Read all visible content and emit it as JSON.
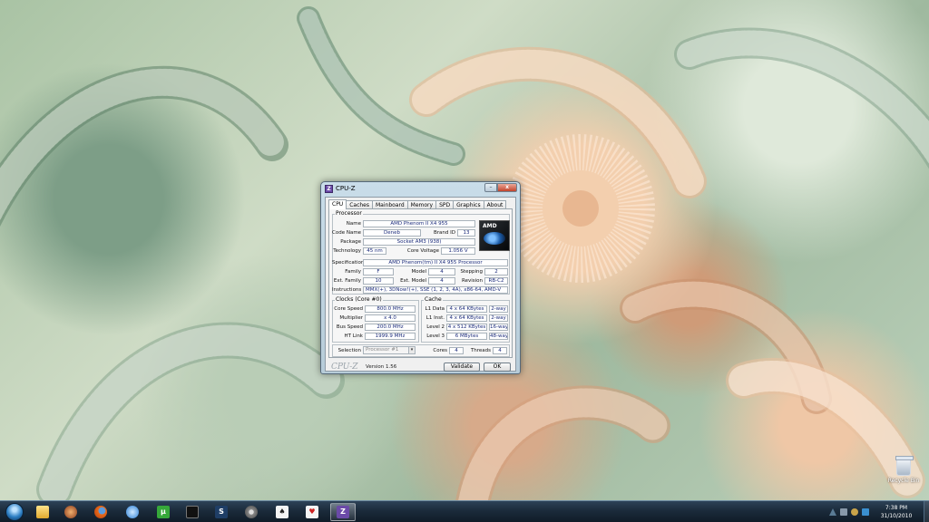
{
  "window": {
    "title": "CPU-Z",
    "icon_label": "Z",
    "min_label": "–",
    "close_label": "x"
  },
  "tabs": [
    "CPU",
    "Caches",
    "Mainboard",
    "Memory",
    "SPD",
    "Graphics",
    "About"
  ],
  "processor": {
    "legend": "Processor",
    "name_label": "Name",
    "name": "AMD Phenom II X4 955",
    "codename_label": "Code Name",
    "codename": "Deneb",
    "brandid_label": "Brand ID",
    "brandid": "13",
    "package_label": "Package",
    "package": "Socket AM3 (938)",
    "technology_label": "Technology",
    "technology": "45 nm",
    "corevoltage_label": "Core Voltage",
    "corevoltage": "1.056 V",
    "spec_label": "Specification",
    "spec": "AMD Phenom(tm) II X4 955 Processor",
    "family_label": "Family",
    "family": "F",
    "model_label": "Model",
    "model": "4",
    "stepping_label": "Stepping",
    "stepping": "2",
    "extfamily_label": "Ext. Family",
    "extfamily": "10",
    "extmodel_label": "Ext. Model",
    "extmodel": "4",
    "revision_label": "Revision",
    "revision": "RB-C2",
    "instructions_label": "Instructions",
    "instructions": "MMX(+), 3DNow!(+), SSE (1, 2, 3, 4A), x86-64, AMD-V"
  },
  "logo": {
    "brand": "AMD",
    "product": "Phenom II"
  },
  "clocks": {
    "legend": "Clocks (Core #0)",
    "corespeed_label": "Core Speed",
    "corespeed": "800.0 MHz",
    "multiplier_label": "Multiplier",
    "multiplier": "x 4.0",
    "busspeed_label": "Bus Speed",
    "busspeed": "200.0 MHz",
    "htlink_label": "HT Link",
    "htlink": "1999.9 MHz"
  },
  "cache": {
    "legend": "Cache",
    "rows": [
      {
        "label": "L1 Data",
        "size": "4 x 64 KBytes",
        "way": "2-way"
      },
      {
        "label": "L1 Inst.",
        "size": "4 x 64 KBytes",
        "way": "2-way"
      },
      {
        "label": "Level 2",
        "size": "4 x 512 KBytes",
        "way": "16-way"
      },
      {
        "label": "Level 3",
        "size": "6 MBytes",
        "way": "48-way"
      }
    ]
  },
  "selection": {
    "label": "Selection",
    "value": "Processor #1",
    "cores_label": "Cores",
    "cores": "4",
    "threads_label": "Threads",
    "threads": "4"
  },
  "footer": {
    "logo": "CPU-Z",
    "version": "Version 1.56",
    "validate": "Validate",
    "ok": "OK"
  },
  "desktop": {
    "recycle_bin_label": "Recycle Bin"
  },
  "taskbar": {
    "time": "7:38 PM",
    "date": "31/10/2010",
    "pinned": [
      "explorer-icon",
      "game-icon",
      "firefox-icon",
      "ie-icon",
      "utorrent-icon",
      "steam-icon",
      "starcraft-icon",
      "settings-icon",
      "solitaire-icon",
      "cards-icon",
      "cpuz-icon"
    ]
  }
}
